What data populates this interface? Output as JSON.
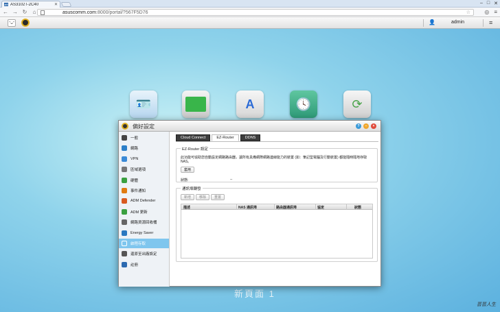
{
  "browser": {
    "tab_title": "AS3102T-2C40",
    "url_host": "asuscomm.com",
    "url_path": ":8000/portal/?567F5D76"
  },
  "header": {
    "user": "admin"
  },
  "desktop": {
    "watermark": "新頁面 1",
    "signature": "芸芸人生"
  },
  "window": {
    "title": "偏好設定",
    "sidebar": [
      {
        "label": "一般",
        "icon": "server-icon",
        "color": "#444"
      },
      {
        "label": "網路",
        "icon": "globe-icon",
        "color": "#2c7fc8"
      },
      {
        "label": "VPN",
        "icon": "vpn-icon",
        "color": "#3a8ad6"
      },
      {
        "label": "區域選項",
        "icon": "region-icon",
        "color": "#777"
      },
      {
        "label": "硬體",
        "icon": "hardware-icon",
        "color": "#3aa040"
      },
      {
        "label": "事件通知",
        "icon": "alert-icon",
        "color": "#e07a10"
      },
      {
        "label": "ADM Defender",
        "icon": "shield-icon",
        "color": "#d85a20"
      },
      {
        "label": "ADM 更新",
        "icon": "update-arrow-icon",
        "color": "#3aa040"
      },
      {
        "label": "網路資源回收桶",
        "icon": "recycle-bin-icon",
        "color": "#666"
      },
      {
        "label": "Energy Saver",
        "icon": "energy-icon",
        "color": "#2a78c0"
      },
      {
        "label": "啟程存取",
        "icon": "cloud-icon",
        "color": "#ffffff"
      },
      {
        "label": "還原至出廠設定",
        "icon": "restore-icon",
        "color": "#555"
      },
      {
        "label": "註冊",
        "icon": "register-icon",
        "color": "#2c6ab0"
      }
    ],
    "active_item": 10,
    "tabs": [
      "Cloud Connect",
      "EZ-Router",
      "DDNS"
    ],
    "active_tab": 1,
    "ez_router": {
      "legend": "EZ-Router 設定",
      "description": "此功能可協助您自動設定網路路由器，讓所有具備網際網路連線能力的裝置 (如：筆記型電腦及行動裝置) 都能隨時隨地存取 NAS。",
      "apply_button": "套用",
      "status_label": "狀態:",
      "status_value": "--"
    },
    "port_forwarding": {
      "legend": "通訊埠轉發",
      "add_button": "新增",
      "delete_button": "移除",
      "reset_button": "重置",
      "columns": [
        "描述",
        "NAS 通訊埠",
        "路由器通訊埠",
        "協定",
        "狀態"
      ]
    }
  }
}
